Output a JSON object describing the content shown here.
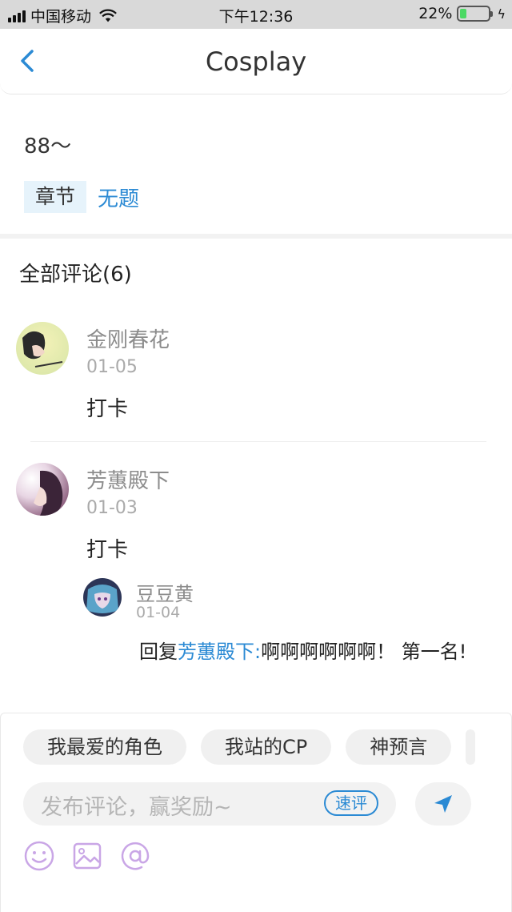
{
  "status_bar": {
    "carrier": "中国移动",
    "time": "下午12:36",
    "battery_percent": "22%",
    "battery_level": 0.22
  },
  "nav": {
    "title": "Cosplay"
  },
  "post": {
    "text": "88～",
    "chapter_tag": "章节",
    "chapter_name": "无题"
  },
  "comments": {
    "header": "全部评论(6)",
    "items": [
      {
        "name": "金刚春花",
        "date": "01-05",
        "text": "打卡"
      },
      {
        "name": "芳蕙殿下",
        "date": "01-03",
        "text": "打卡"
      }
    ],
    "reply": {
      "name": "豆豆黄",
      "date": "01-04",
      "prefix": "回复",
      "mention": "芳蕙殿下:",
      "text": "啊啊啊啊啊啊！ 第一名!"
    }
  },
  "bottom": {
    "chips": [
      "我最爱的角色",
      "我站的CP",
      "神预言"
    ],
    "input_placeholder": "发布评论，赢奖励~",
    "quick_review": "速评",
    "icons": [
      "smile-icon",
      "image-icon",
      "at-icon"
    ],
    "accent_color": "#2b8ad4",
    "tool_icon_color": "#c9a6e6"
  }
}
